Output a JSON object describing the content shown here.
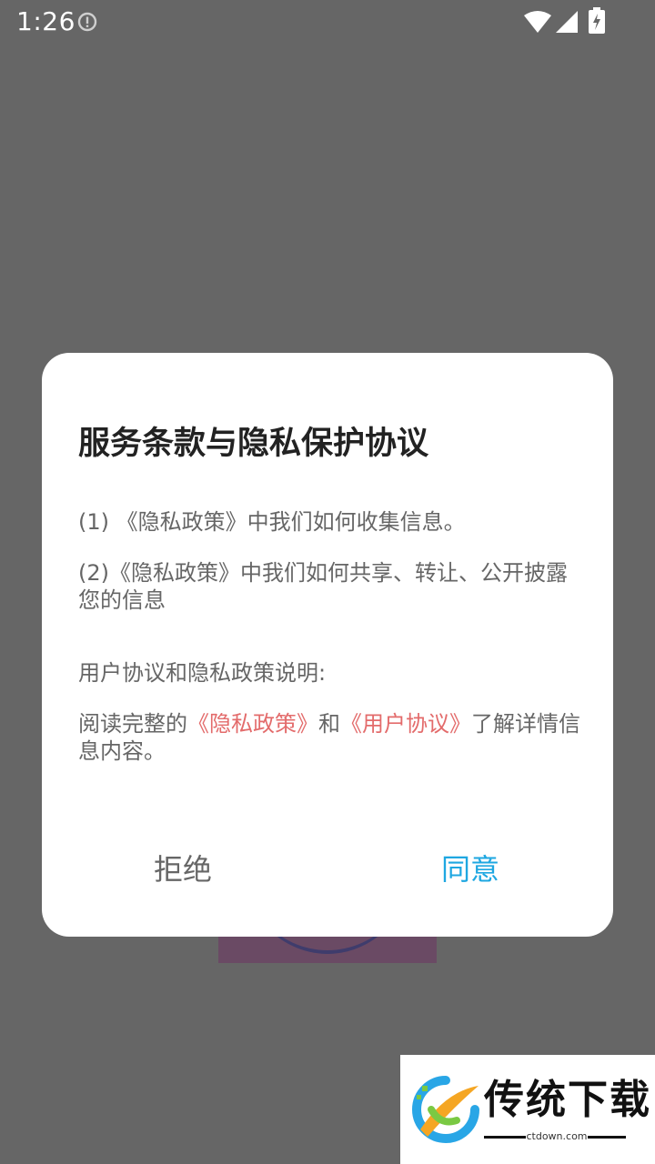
{
  "status_bar": {
    "time": "1:26"
  },
  "dialog": {
    "title": "服务条款与隐私保护协议",
    "items": [
      {
        "prefix": "(1) ",
        "link": "《隐私政策》",
        "text": "中我们如何收集信息。"
      },
      {
        "prefix": "(2)",
        "link": "《隐私政策》",
        "text": "中我们如何共享、转让、公开披露您的信息"
      }
    ],
    "explanation_heading": "用户协议和隐私政策说明:",
    "explanation": {
      "before": "阅读完整的",
      "privacy_link": "《隐私政策》",
      "middle": "和",
      "user_link": "《用户协议》",
      "after": "了解详情信息内容。"
    },
    "reject_label": "拒绝",
    "agree_label": "同意"
  },
  "watermark": {
    "name": "传统下载",
    "domain": "ctdown.com"
  },
  "colors": {
    "overlay": "#666666",
    "dialog_bg": "#ffffff",
    "title": "#222222",
    "body_text": "#666666",
    "link": "#e36b6b",
    "agree": "#1ea7e1",
    "reject": "#666666"
  },
  "icons": {
    "status_info": "info-circle-icon",
    "status_wifi": "wifi-icon",
    "status_signal": "cell-signal-icon",
    "status_battery": "battery-charging-icon",
    "watermark_logo": "ctdown-logo-icon"
  }
}
